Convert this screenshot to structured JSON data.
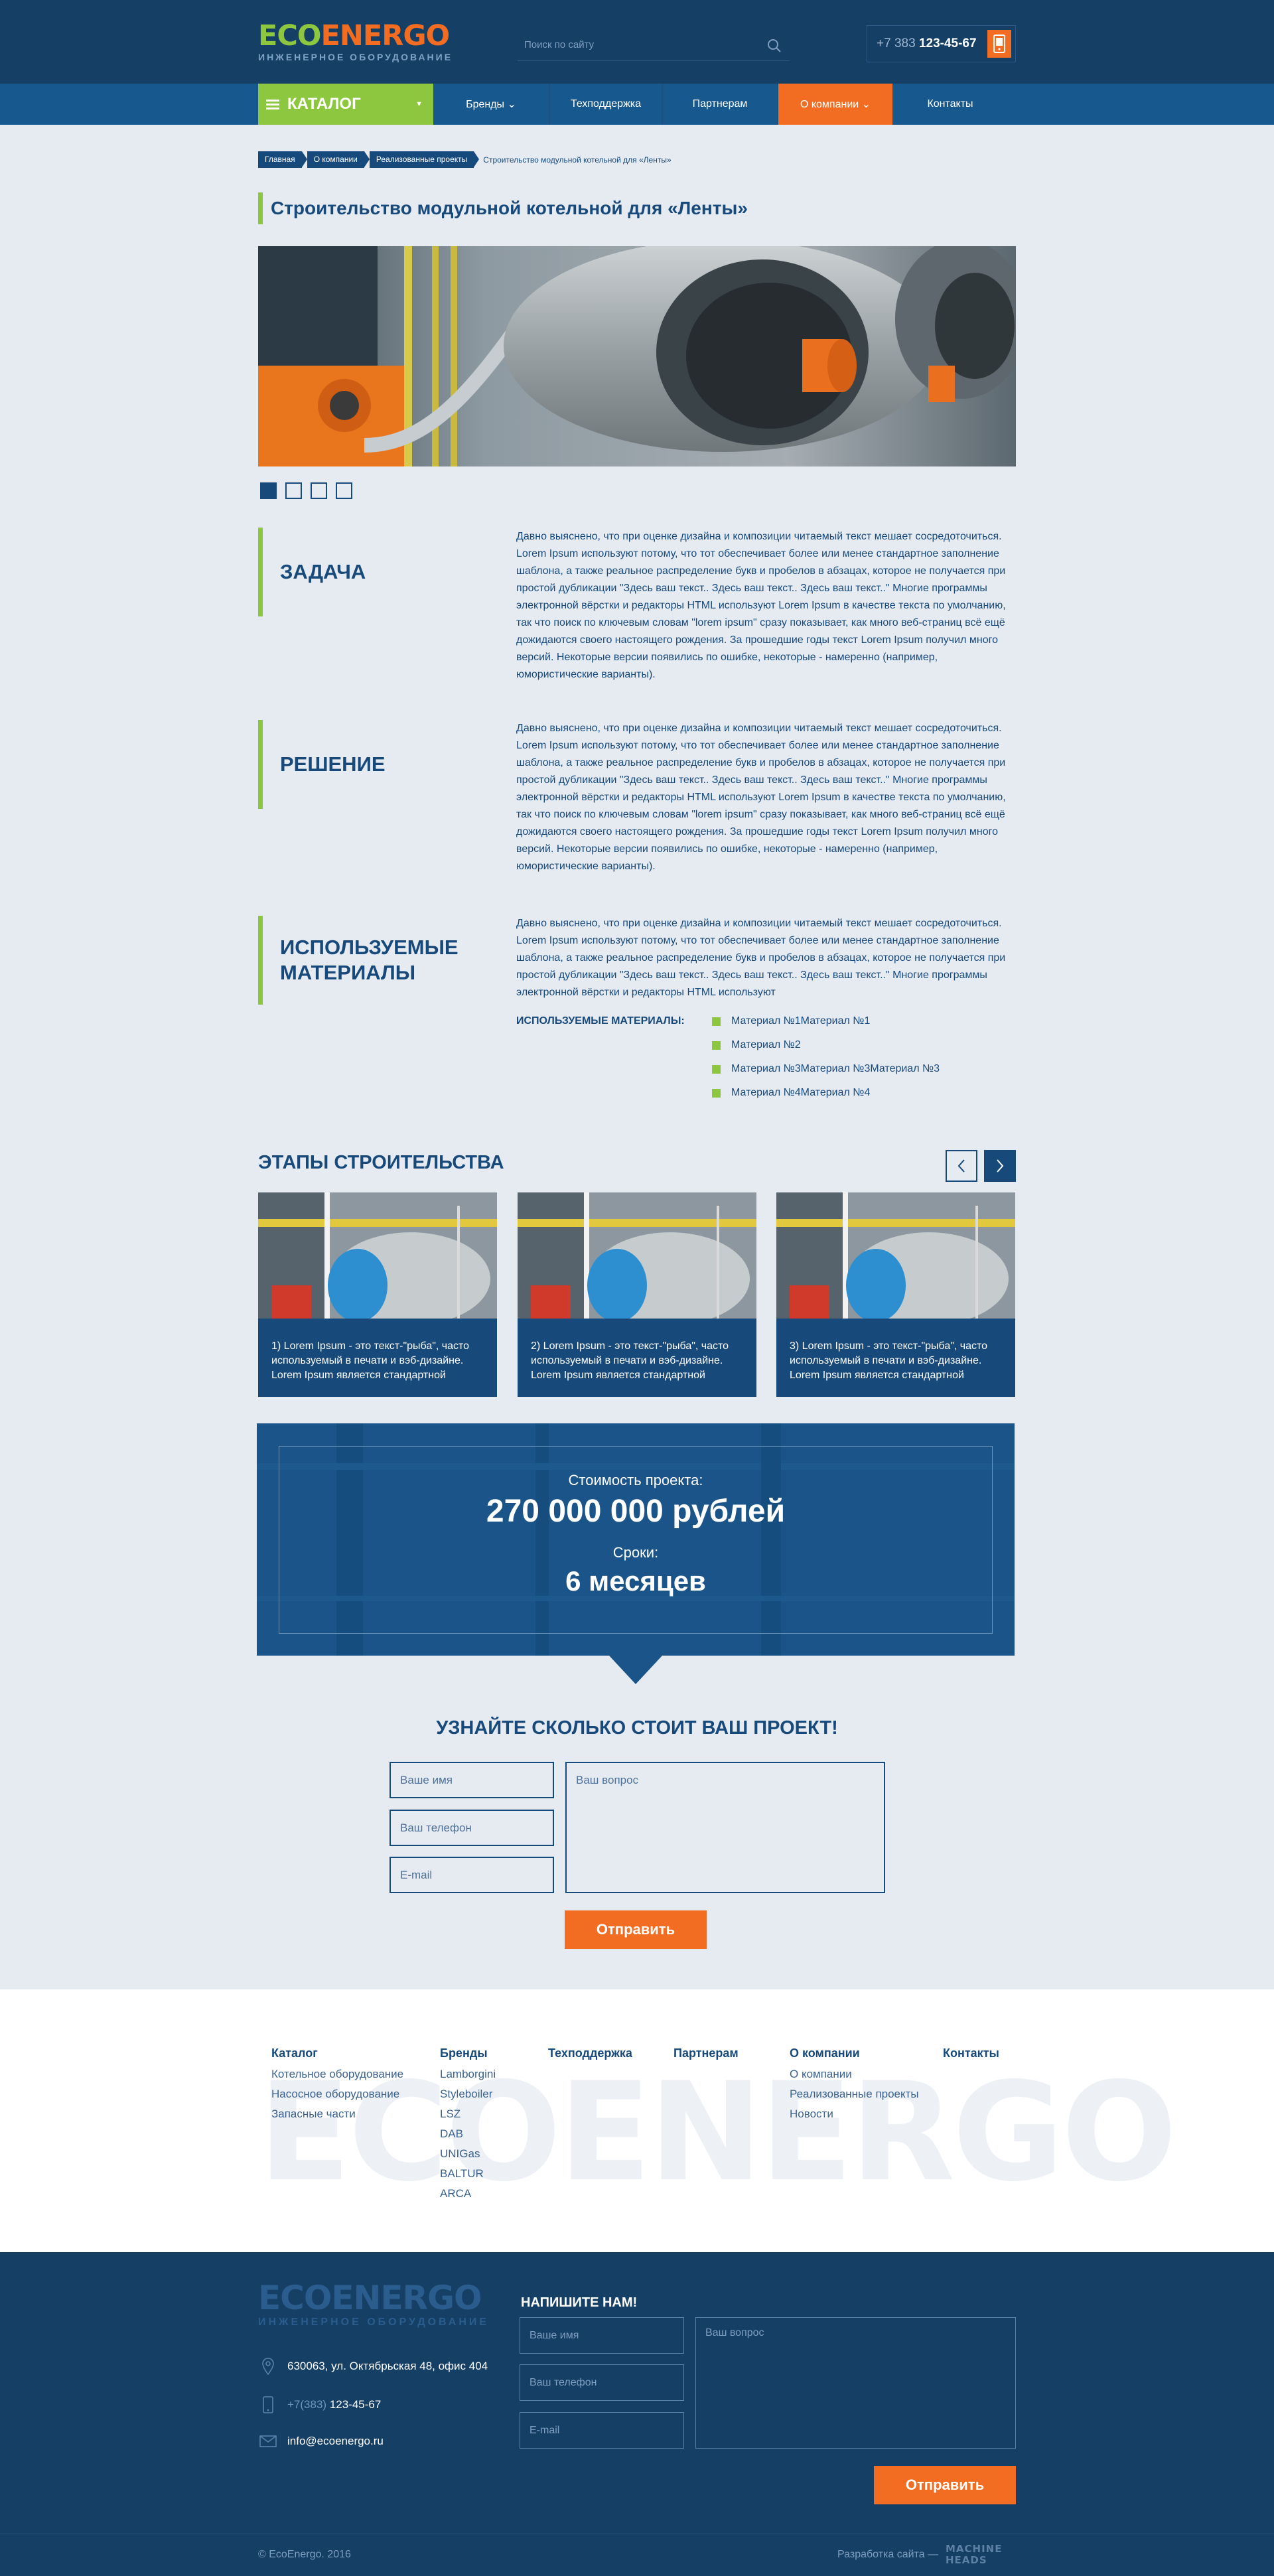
{
  "header": {
    "logo_eco": "ECO",
    "logo_energo": "ENERGO",
    "logo_sub": "ИНЖЕНЕРНОЕ ОБОРУДОВАНИЕ",
    "search_placeholder": "Поиск по сайту",
    "phone_prefix": "+7 383",
    "phone_number": "123-45-67"
  },
  "nav": {
    "catalog": "КАТАЛОГ",
    "items": [
      {
        "label": "Бренды ⌄"
      },
      {
        "label": "Техподдержка"
      },
      {
        "label": "Партнерам"
      },
      {
        "label": "О компании ⌄"
      },
      {
        "label": "Контакты"
      }
    ]
  },
  "breadcrumb": {
    "items": [
      "Главная",
      "О компании",
      "Реализованные проекты"
    ],
    "current": "Строительство модульной котельной для «Ленты»"
  },
  "page": {
    "title": "Строительство модульной котельной для «Ленты»"
  },
  "sections": [
    {
      "heading": "ЗАДАЧА",
      "text": "Давно выяснено, что при оценке дизайна и композиции читаемый текст мешает сосредоточиться. Lorem Ipsum используют потому, что тот обеспечивает более или менее стандартное заполнение шаблона, а также реальное распределение букв и пробелов в абзацах, которое не получается при простой дубликации \"Здесь ваш текст.. Здесь ваш текст.. Здесь ваш текст..\" Многие программы электронной вёрстки и редакторы HTML используют Lorem Ipsum в качестве текста по умолчанию, так что поиск по ключевым словам \"lorem ipsum\" сразу показывает, как много веб-страниц всё ещё дожидаются своего настоящего рождения. За прошедшие годы текст Lorem Ipsum получил много версий. Некоторые версии появились по ошибке, некоторые - намеренно (например, юмористические варианты)."
    },
    {
      "heading": "РЕШЕНИЕ",
      "text": "Давно выяснено, что при оценке дизайна и композиции читаемый текст мешает сосредоточиться. Lorem Ipsum используют потому, что тот обеспечивает более или менее стандартное заполнение шаблона, а также реальное распределение букв и пробелов в абзацах, которое не получается при простой дубликации \"Здесь ваш текст.. Здесь ваш текст.. Здесь ваш текст..\" Многие программы электронной вёрстки и редакторы HTML используют Lorem Ipsum в качестве текста по умолчанию, так что поиск по ключевым словам \"lorem ipsum\" сразу показывает, как много веб-страниц всё ещё дожидаются своего настоящего рождения. За прошедшие годы текст Lorem Ipsum получил много версий. Некоторые версии появились по ошибке, некоторые - намеренно (например, юмористические варианты)."
    },
    {
      "heading": "ИСПОЛЬЗУЕМЫЕ МАТЕРИАЛЫ",
      "text": "Давно выяснено, что при оценке дизайна и композиции читаемый текст мешает сосредоточиться. Lorem Ipsum используют потому, что тот обеспечивает более или менее стандартное заполнение шаблона, а также реальное распределение букв и пробелов в абзацах, которое не получается при простой дубликации \"Здесь ваш текст.. Здесь ваш текст.. Здесь ваш текст..\" Многие программы электронной вёрстки и редакторы HTML используют"
    }
  ],
  "materials": {
    "label": "ИСПОЛЬЗУЕМЫЕ МАТЕРИАЛЫ:",
    "items": [
      "Материал №1Материал №1",
      "Материал №2",
      "Материал №3Материал №3Материал №3",
      "Материал №4Материал №4"
    ]
  },
  "stages": {
    "title": "ЭТАПЫ СТРОИТЕЛЬСТВА",
    "cards": [
      {
        "text": "1) Lorem Ipsum - это текст-\"рыба\", часто используемый в печати и вэб-дизайне. Lorem Ipsum является стандартной"
      },
      {
        "text": "2) Lorem Ipsum - это текст-\"рыба\", часто используемый в печати и вэб-дизайне. Lorem Ipsum является стандартной"
      },
      {
        "text": "3) Lorem Ipsum - это текст-\"рыба\", часто используемый в печати и вэб-дизайне. Lorem Ipsum является стандартной"
      }
    ]
  },
  "cost": {
    "label": "Стоимость проекта:",
    "value": "270 000 000 рублей",
    "term_label": "Сроки:",
    "term_value": "6 месяцев"
  },
  "form": {
    "title": "УЗНАЙТЕ СКОЛЬКО СТОИТ ВАШ ПРОЕКТ!",
    "name_placeholder": "Ваше имя",
    "phone_placeholder": "Ваш телефон",
    "email_placeholder": "E-mail",
    "question_placeholder": "Ваш вопрос",
    "submit": "Отправить"
  },
  "footer_nav": {
    "bg_word": "ECOENERGO",
    "columns": [
      {
        "heading": "Каталог",
        "links": [
          "Котельное оборудование",
          "Насосное оборудование",
          "Запасные части"
        ]
      },
      {
        "heading": "Бренды",
        "links": [
          "Lamborgini",
          "Styleboiler",
          "LSZ",
          "DAB",
          "UNIGas",
          "BALTUR",
          "ARCA"
        ]
      },
      {
        "heading": "Техподдержка",
        "links": []
      },
      {
        "heading": "Партнерам",
        "links": []
      },
      {
        "heading": "О компании",
        "links": [
          "О компании",
          "Реализованные проекты",
          "Новости"
        ]
      },
      {
        "heading": "Контакты",
        "links": []
      }
    ]
  },
  "footer": {
    "logo": "ECOENERGO",
    "logo_sub": "ИНЖЕНЕРНОЕ ОБОРУДОВАНИЕ",
    "address": "630063, ул. Октябрьская 48, офис 404",
    "phone_prefix": "+7(383)",
    "phone_number": "123-45-67",
    "email": "info@ecoenergo.ru",
    "write_title": "НАПИШИТЕ НАМ!",
    "name_placeholder": "Ваше имя",
    "phone_placeholder": "Ваш телефон",
    "email_placeholder": "E-mail",
    "question_placeholder": "Ваш вопрос",
    "submit": "Отправить",
    "copyright": "© EcoEnergo. 2016",
    "dev_label": "Разработка сайта —",
    "dev_name": "MACHINE HEADS"
  },
  "colors": {
    "navy": "#163f66",
    "nav_blue": "#17588e",
    "accent_green": "#8dc63f",
    "accent_orange": "#f26d21",
    "page_bg": "#e6ebf2",
    "text": "#17497a"
  }
}
